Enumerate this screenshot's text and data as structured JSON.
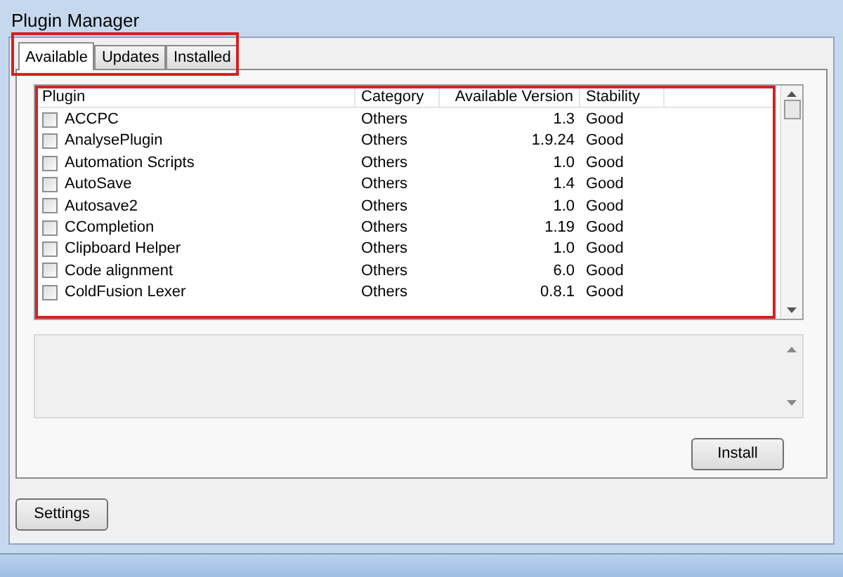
{
  "window": {
    "title": "Plugin Manager"
  },
  "tabs": [
    {
      "label": "Available",
      "selected": true
    },
    {
      "label": "Updates",
      "selected": false
    },
    {
      "label": "Installed",
      "selected": false
    }
  ],
  "table": {
    "columns": [
      "Plugin",
      "Category",
      "Available Version",
      "Stability"
    ],
    "rows": [
      {
        "checked": false,
        "cells": [
          "ACCPC",
          "Others",
          "1.3",
          "Good"
        ]
      },
      {
        "checked": false,
        "cells": [
          "AnalysePlugin",
          "Others",
          "1.9.24",
          "Good"
        ]
      },
      {
        "checked": false,
        "cells": [
          "Automation Scripts",
          "Others",
          "1.0",
          "Good"
        ]
      },
      {
        "checked": false,
        "cells": [
          "AutoSave",
          "Others",
          "1.4",
          "Good"
        ]
      },
      {
        "checked": false,
        "cells": [
          "Autosave2",
          "Others",
          "1.0",
          "Good"
        ]
      },
      {
        "checked": false,
        "cells": [
          "CCompletion",
          "Others",
          "1.19",
          "Good"
        ]
      },
      {
        "checked": false,
        "cells": [
          "Clipboard Helper",
          "Others",
          "1.0",
          "Good"
        ]
      },
      {
        "checked": false,
        "cells": [
          "Code alignment",
          "Others",
          "6.0",
          "Good"
        ]
      },
      {
        "checked": false,
        "cells": [
          "ColdFusion Lexer",
          "Others",
          "0.8.1",
          "Good"
        ]
      }
    ]
  },
  "buttons": {
    "install": "Install",
    "settings": "Settings"
  }
}
